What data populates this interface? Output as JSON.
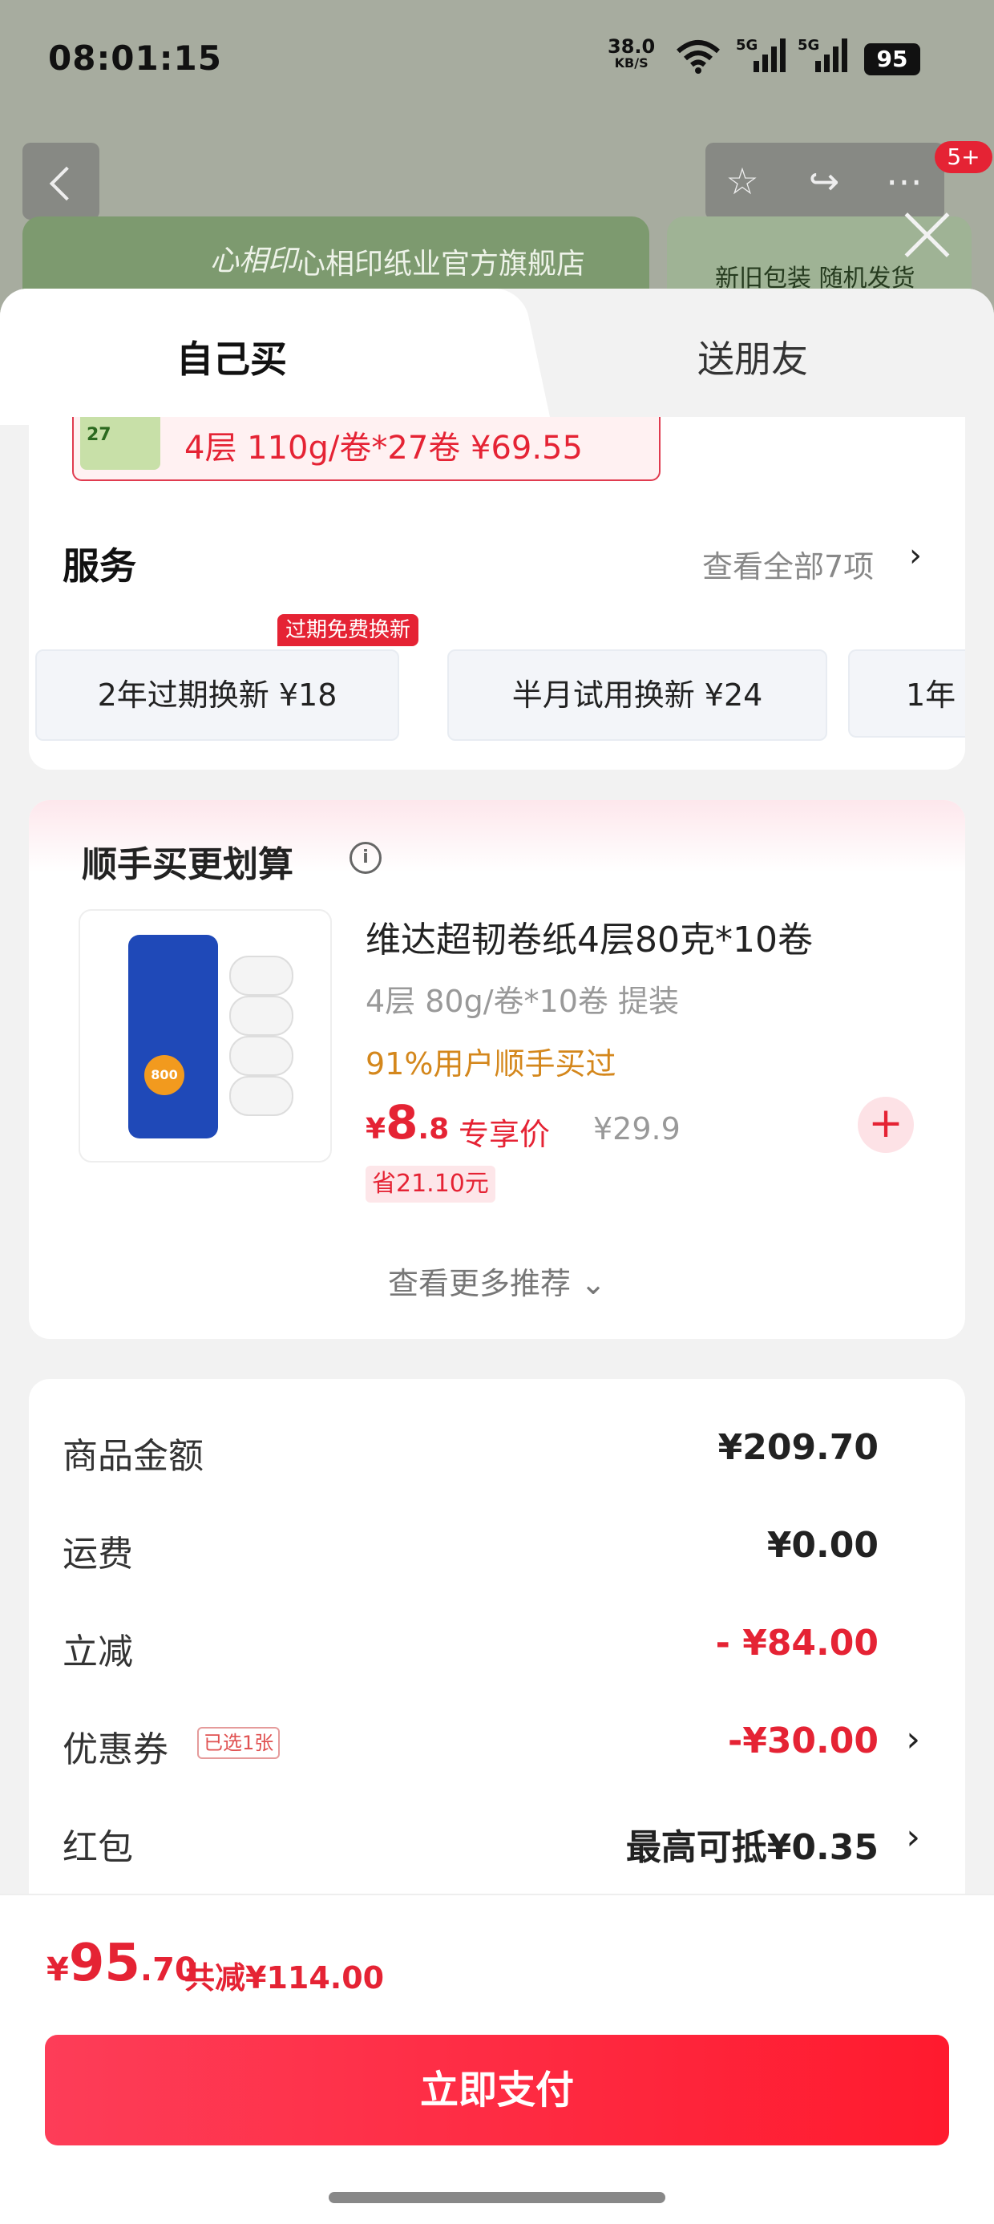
{
  "status_bar": {
    "time": "08:01:15",
    "net_speed": "38.0",
    "net_unit": "KB/S",
    "signal1": "5G",
    "signal2": "5G",
    "battery": "95"
  },
  "background": {
    "badge_count": "5+",
    "store_name": "心相印纸业官方旗舰店",
    "store_logo": "心相印",
    "packaging_text": "新旧包装 随机发货"
  },
  "tabs": {
    "self": "自己买",
    "gift": "送朋友"
  },
  "selected_variant": {
    "text": "4层 110g/卷*27卷  ¥69.55",
    "thumb_label": "27"
  },
  "service": {
    "title": "服务",
    "view_all": "查看全部7项",
    "badge": "过期免费换新",
    "options": [
      {
        "label": "2年过期换新  ¥18"
      },
      {
        "label": "半月试用换新  ¥24"
      },
      {
        "label": "1年"
      }
    ]
  },
  "addon": {
    "title": "顺手买更划算",
    "product_name": "维达超韧卷纸4层80克*10卷",
    "spec": "4层 80g/卷*10卷 提装",
    "social_proof": "91%用户顺手买过",
    "price_currency": "¥",
    "price_int": "8",
    "price_dec": ".8",
    "price_tag": "专享价",
    "original_price": "¥29.9",
    "save_badge": "省21.10元",
    "more_label": "查看更多推荐"
  },
  "summary": {
    "goods_label": "商品金额",
    "goods_value": "¥209.70",
    "shipping_label": "运费",
    "shipping_value": "¥0.00",
    "discount_label": "立减",
    "discount_value": "- ¥84.00",
    "coupon_label": "优惠券",
    "coupon_badge": "已选1张",
    "coupon_value": "-¥30.00",
    "redpacket_label": "红包",
    "redpacket_value": "最高可抵¥0.35"
  },
  "footer": {
    "currency": "¥",
    "total_int": "95",
    "total_dec": ".70",
    "total_saved": "共减¥114.00",
    "pay_button": "立即支付"
  },
  "colors": {
    "accent": "#e52334",
    "pay_gradient_start": "#fd3d58",
    "pay_gradient_end": "#ff1a2e",
    "social_proof": "#d4871c"
  }
}
